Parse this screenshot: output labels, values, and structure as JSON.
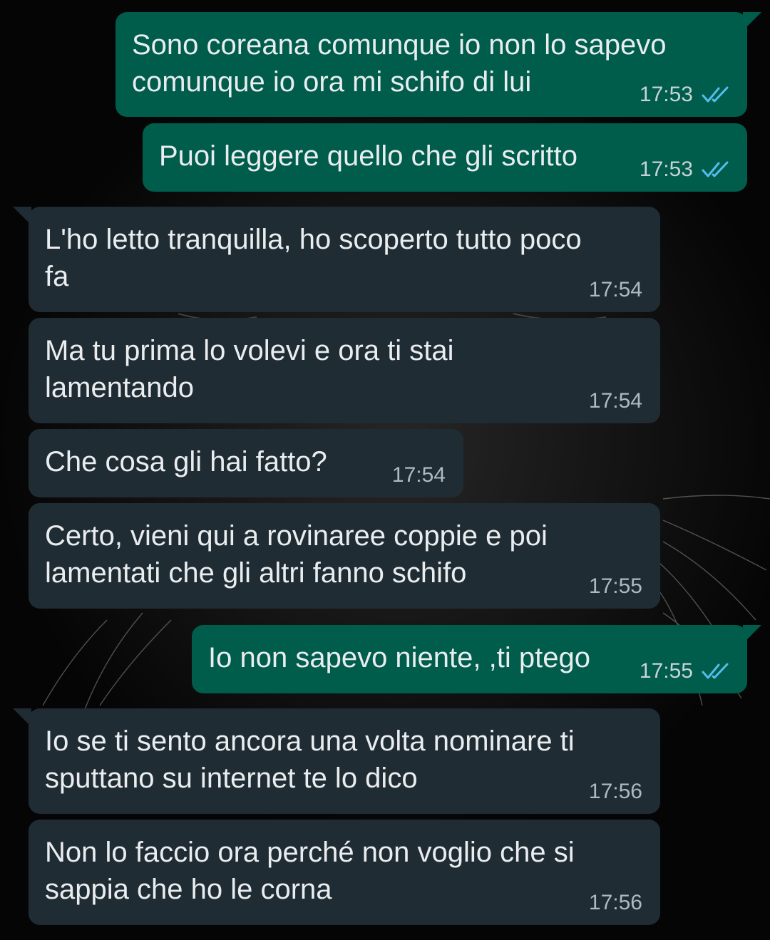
{
  "messages": [
    {
      "direction": "out",
      "lines": "Sono coreana comunque io non lo sapevo\ncomunque io ora mi schifo di lui",
      "time": "17:53",
      "read": true
    },
    {
      "direction": "out",
      "lines": "Puoi leggere quello che gli scritto",
      "time": "17:53",
      "read": true
    },
    {
      "direction": "in",
      "lines": "L'ho letto tranquilla, ho scoperto tutto poco\nfa",
      "time": "17:54"
    },
    {
      "direction": "in",
      "lines": "Ma tu prima lo volevi e ora ti stai\nlamentando",
      "time": "17:54"
    },
    {
      "direction": "in",
      "lines": "Che cosa gli hai fatto?",
      "time": "17:54"
    },
    {
      "direction": "in",
      "lines": "Certo, vieni qui a rovinaree coppie e poi\nlamentati che gli altri fanno schifo",
      "time": "17:55"
    },
    {
      "direction": "out",
      "lines": "Io non sapevo niente, ,ti ptego",
      "time": "17:55",
      "read": true
    },
    {
      "direction": "in",
      "lines": "Io se ti sento ancora una volta nominare ti\nsputtano su internet te lo dico",
      "time": "17:56"
    },
    {
      "direction": "in",
      "lines": "Non lo faccio ora perché non voglio che si\nsappia che ho le corna",
      "time": "17:56"
    }
  ],
  "colors": {
    "outgoing_bubble": "#005c4b",
    "incoming_bubble": "#202c33",
    "background": "#050505",
    "read_ticks": "#53bdeb"
  },
  "icons": {
    "read_receipt": "double-check-icon"
  }
}
